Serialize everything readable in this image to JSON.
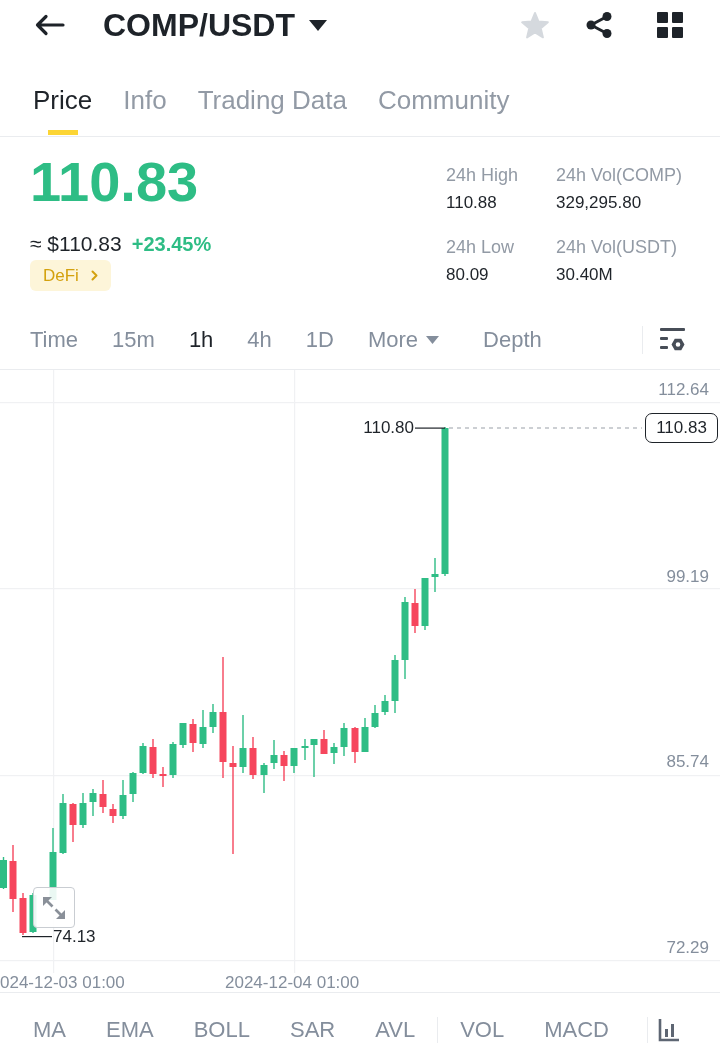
{
  "header": {
    "title": "COMP/USDT",
    "favorited": false
  },
  "tabs": [
    {
      "label": "Price",
      "selected": true
    },
    {
      "label": "Info",
      "selected": false
    },
    {
      "label": "Trading Data",
      "selected": false
    },
    {
      "label": "Community",
      "selected": false
    }
  ],
  "price": {
    "last": "110.83",
    "fiat": "≈ $110.83",
    "change": "+23.45%",
    "tag": "DeFi"
  },
  "stats": [
    {
      "label": "24h High",
      "value": "110.88"
    },
    {
      "label": "24h Vol(COMP)",
      "value": "329,295.80"
    },
    {
      "label": "24h Low",
      "value": "80.09"
    },
    {
      "label": "24h Vol(USDT)",
      "value": "30.40M"
    }
  ],
  "intervals": [
    {
      "label": "Time",
      "kind": "option",
      "selected": false
    },
    {
      "label": "15m",
      "kind": "option",
      "selected": false
    },
    {
      "label": "1h",
      "kind": "option",
      "selected": true
    },
    {
      "label": "4h",
      "kind": "option",
      "selected": false
    },
    {
      "label": "1D",
      "kind": "option",
      "selected": false
    },
    {
      "label": "More",
      "kind": "dropdown",
      "selected": false
    },
    {
      "label": "Depth",
      "kind": "option",
      "selected": false
    }
  ],
  "chart": {
    "price_ticks": [
      "112.64",
      "99.19",
      "85.74",
      "72.29"
    ],
    "time_labels": [
      "024-12-03 01:00",
      "2024-12-04 01:00"
    ],
    "high_label": "110.80",
    "low_label": "74.13",
    "last_price": "110.83"
  },
  "indicator_groups": [
    [
      "MA",
      "EMA",
      "BOLL",
      "SAR",
      "AVL"
    ],
    [
      "VOL",
      "MACD"
    ]
  ]
}
